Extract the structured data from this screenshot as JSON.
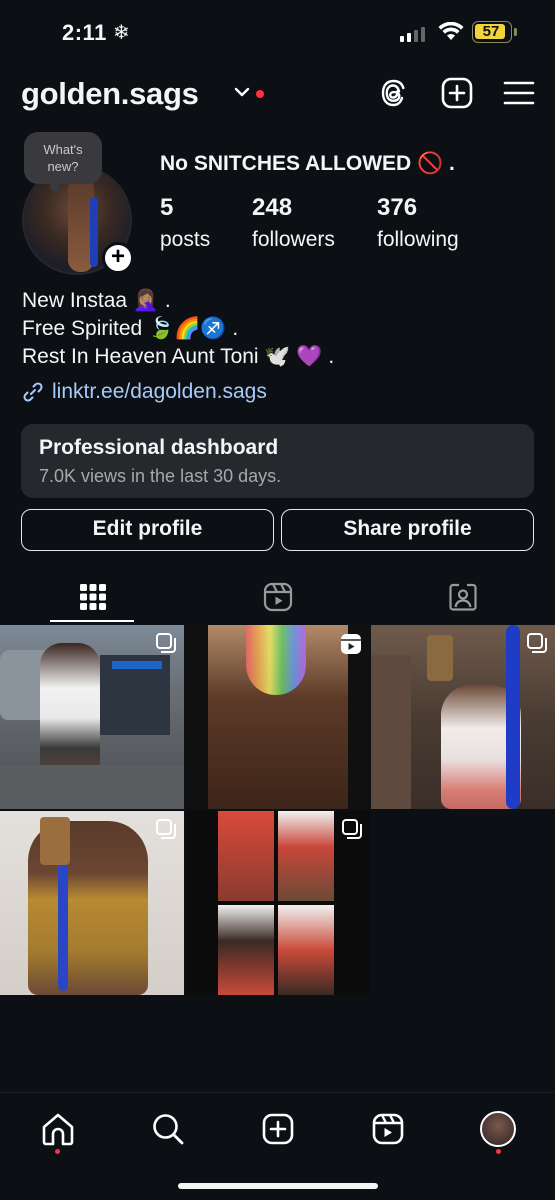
{
  "status_bar": {
    "time": "2:11",
    "weather_glyph": "❄",
    "battery": "57",
    "colors": {
      "battery": "#f3d33c"
    }
  },
  "header": {
    "username": "golden.sags",
    "icons": [
      "threads-icon",
      "create-post-icon",
      "menu-icon"
    ]
  },
  "profile": {
    "note_bubble": "What's new?",
    "display_name": "No SNITCHES ALLOWED 🚫 .",
    "stats": [
      {
        "value": "5",
        "label": "posts"
      },
      {
        "value": "248",
        "label": "followers"
      },
      {
        "value": "376",
        "label": "following"
      }
    ],
    "bio": [
      "New Instaa 🤦🏽‍♀️ .",
      "Free Spirited 🍃🌈♐️ .",
      "Rest In Heaven Aunt Toni 🕊️ 💜 ."
    ],
    "link": "linktr.ee/dagolden.sags",
    "link_color": "#a6cbfa"
  },
  "dashboard": {
    "title": "Professional dashboard",
    "subtitle": "7.0K views in the last 30 days."
  },
  "actions": {
    "edit_profile": "Edit profile",
    "share_profile": "Share profile"
  },
  "tabs": [
    "grid-icon",
    "reels-icon",
    "tagged-icon"
  ],
  "posts": [
    {
      "kind": "carousel",
      "palette": [
        "#6b7c8f",
        "#c9c9c9",
        "#3b3b3f"
      ]
    },
    {
      "kind": "reel",
      "palette": [
        "#8a6a55",
        "#c58a9c",
        "#2b2b2b"
      ]
    },
    {
      "kind": "carousel",
      "palette": [
        "#4a3a30",
        "#dedede",
        "#c26b64"
      ]
    },
    {
      "kind": "carousel",
      "palette": [
        "#d9d4cf",
        "#b08a3a",
        "#6b4a36"
      ]
    },
    {
      "kind": "carousel",
      "palette": [
        "#c94a3a",
        "#f1f1f1",
        "#0b0b0b"
      ]
    }
  ],
  "bottom_nav": [
    "home-icon",
    "search-icon",
    "create-icon",
    "reels-icon",
    "profile-avatar"
  ]
}
